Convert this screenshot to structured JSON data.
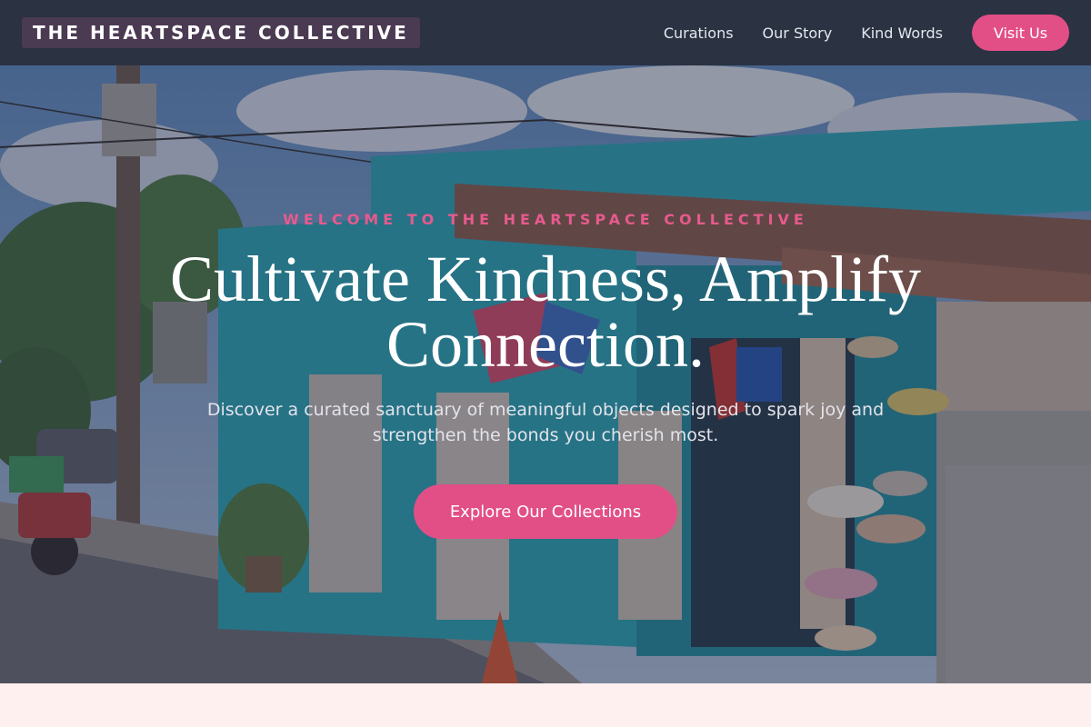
{
  "header": {
    "logo": "THE HEARTSPACE COLLECTIVE",
    "nav": [
      "Curations",
      "Our Story",
      "Kind Words"
    ],
    "cta": "Visit Us"
  },
  "hero": {
    "eyebrow": "WELCOME TO THE HEARTSPACE COLLECTIVE",
    "headline": "Cultivate Kindness, Amplify Connection.",
    "subtext": "Discover a curated sanctuary of meaningful objects designed to spark joy and strengthen the bonds you cherish most.",
    "button": "Explore Our Collections"
  },
  "colors": {
    "header_bg": "#2b3242",
    "accent": "#e24f86",
    "page_bg": "#fdf0ee"
  }
}
